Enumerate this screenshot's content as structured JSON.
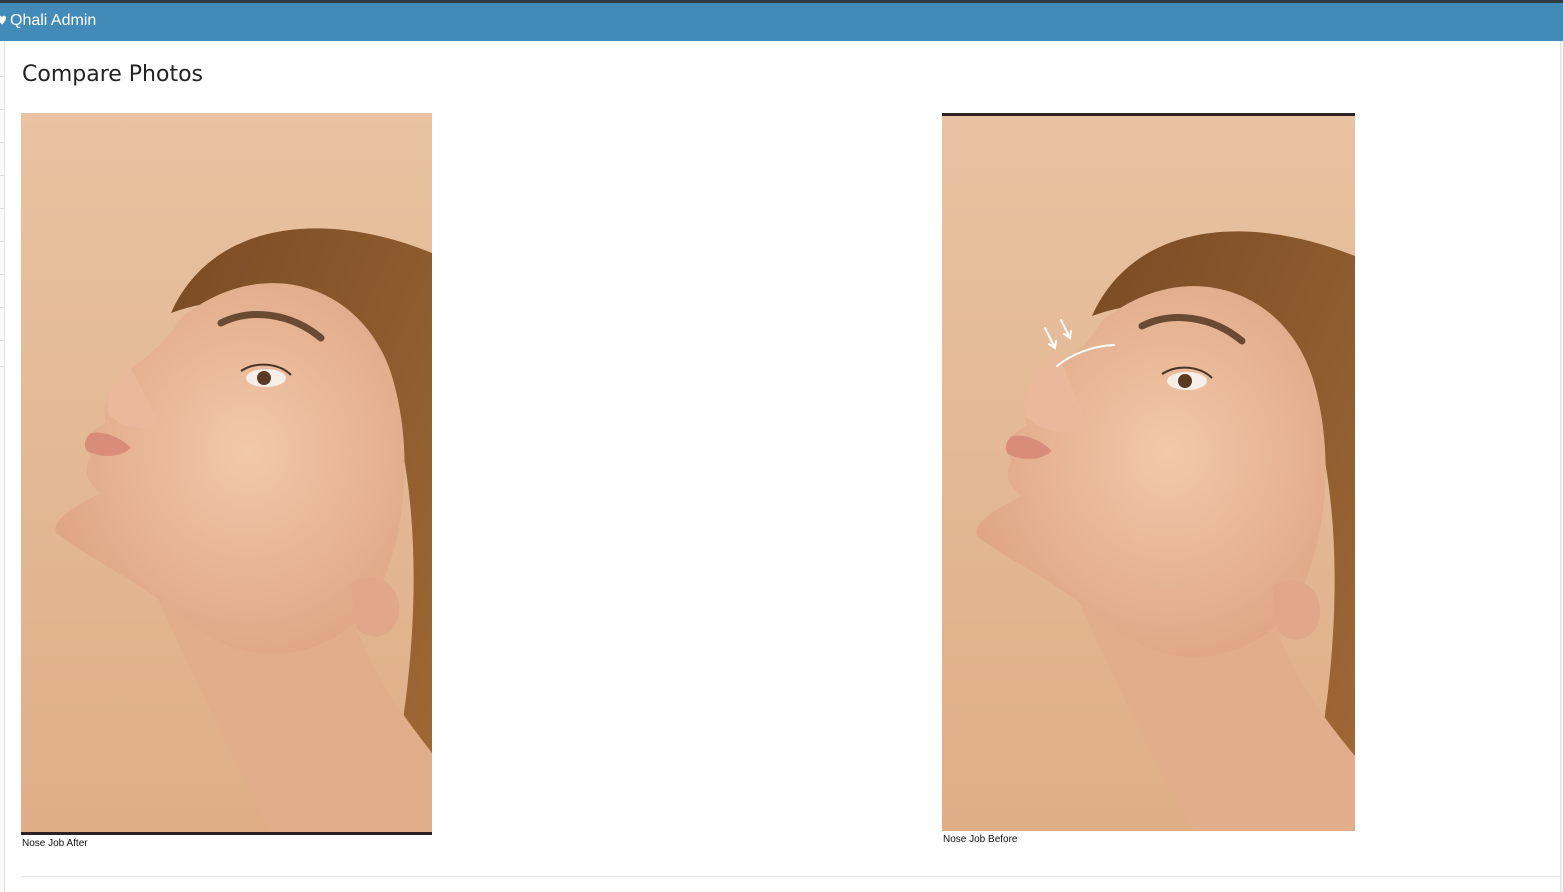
{
  "header": {
    "brand_label": "Qhali Admin",
    "brand_icon": "heart-icon",
    "background_color": "#428bb8"
  },
  "page": {
    "title": "Compare Photos"
  },
  "photos": [
    {
      "caption": "Nose Job After",
      "image": "woman-profile-photo"
    },
    {
      "caption": "Nose Job Before",
      "image": "woman-profile-photo-with-arrows"
    }
  ]
}
